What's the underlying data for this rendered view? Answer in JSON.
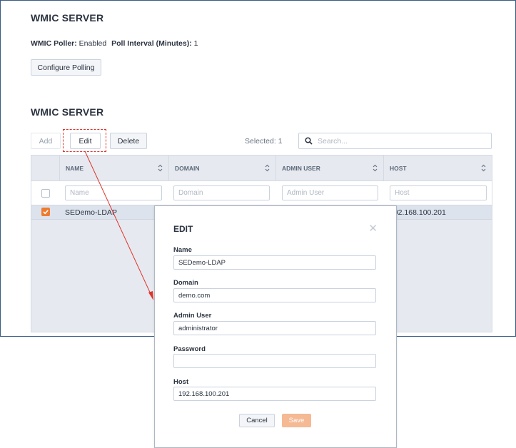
{
  "top_section": {
    "title": "WMIC SERVER",
    "poller_label": "WMIC Poller:",
    "poller_value": "Enabled",
    "interval_label": "Poll Interval (Minutes):",
    "interval_value": "1",
    "configure_button": "Configure Polling"
  },
  "server_section": {
    "title": "WMIC SERVER",
    "toolbar": {
      "add_label": "Add",
      "edit_label": "Edit",
      "delete_label": "Delete",
      "selected_text": "Selected: 1",
      "search_placeholder": "Search..."
    },
    "table": {
      "columns": [
        "NAME",
        "DOMAIN",
        "ADMIN USER",
        "HOST"
      ],
      "filter_placeholders": [
        "Name",
        "Domain",
        "Admin User",
        "Host"
      ],
      "rows": [
        {
          "name": "SEDemo-LDAP",
          "host": "192.168.100.201",
          "checked": true
        }
      ]
    }
  },
  "edit_modal": {
    "title": "EDIT",
    "fields": {
      "name_label": "Name",
      "name_value": "SEDemo-LDAP",
      "domain_label": "Domain",
      "domain_value": "demo.com",
      "admin_label": "Admin User",
      "admin_value": "administrator",
      "password_label": "Password",
      "password_value": "",
      "host_label": "Host",
      "host_value": "192.168.100.201"
    },
    "cancel_label": "Cancel",
    "save_label": "Save"
  },
  "colors": {
    "accent_orange": "#ee7b30",
    "save_disabled": "#f5b994",
    "annotation_red": "#e0342b",
    "panel_border": "#3a5a85"
  }
}
